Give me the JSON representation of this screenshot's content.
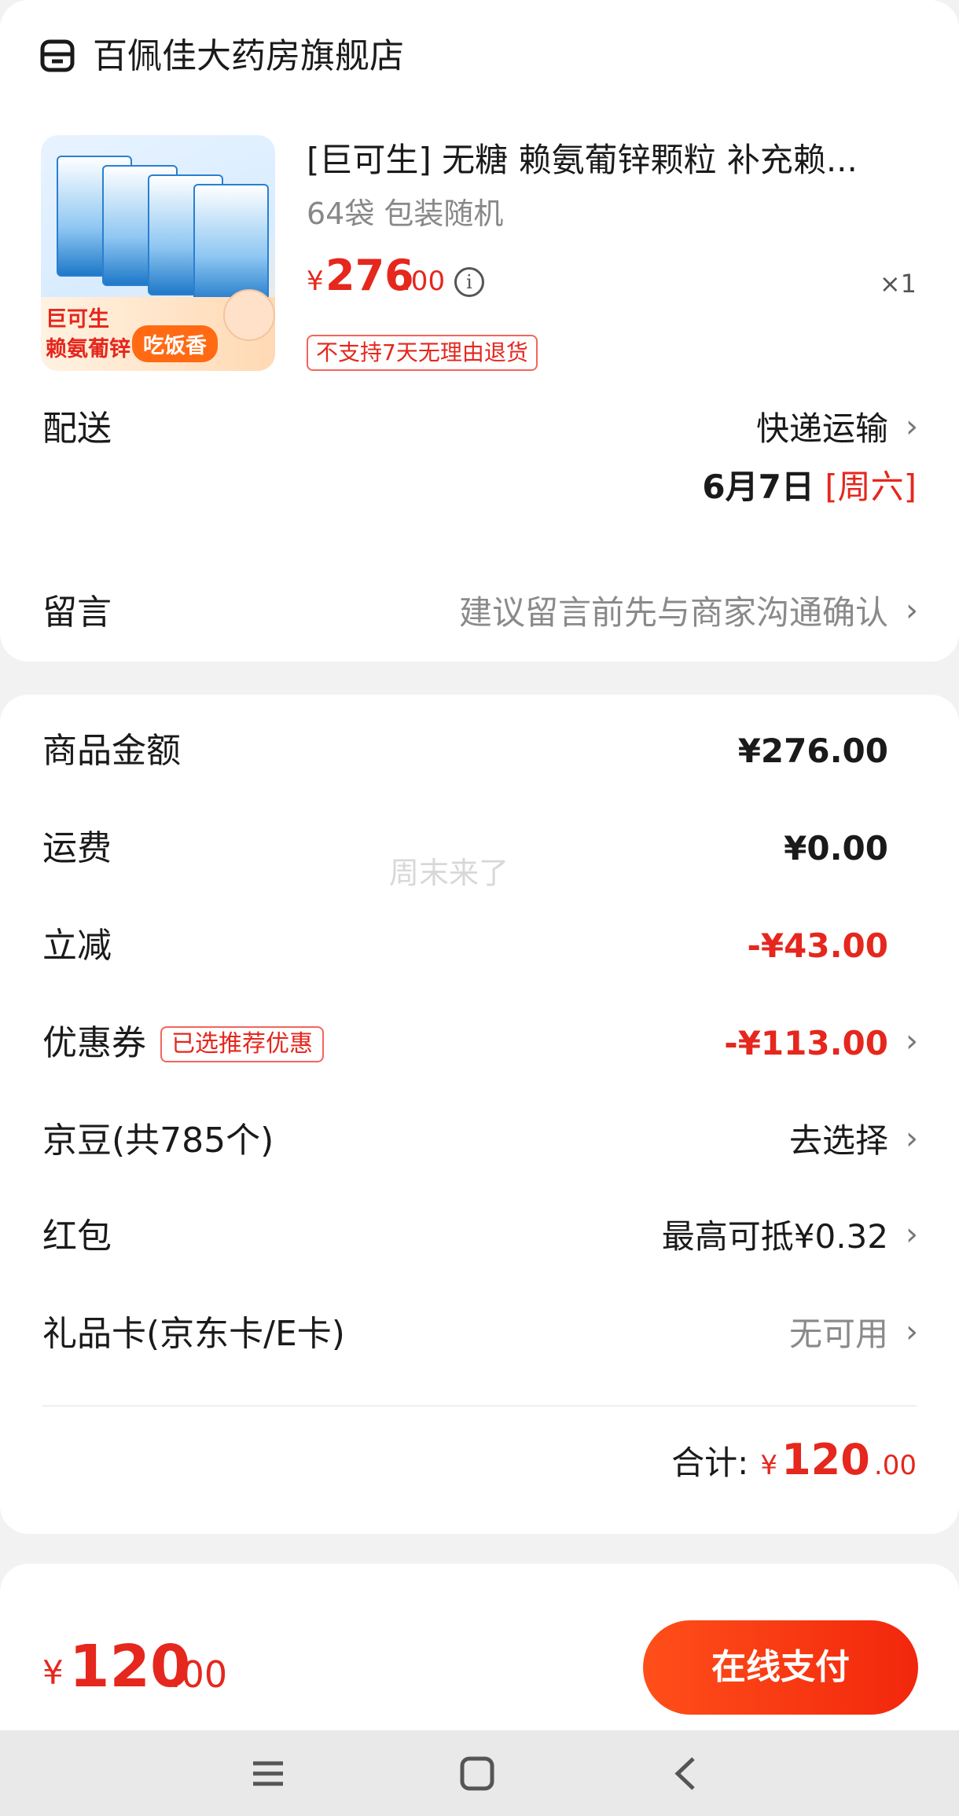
{
  "store": {
    "name": "百佩佳大药房旗舰店",
    "icon": "store-icon"
  },
  "product": {
    "title": "[巨可生] 无糖 赖氨葡锌颗粒 补充赖...",
    "spec": "64袋 包装随机",
    "price_symbol": "¥",
    "price_int": "276",
    "price_dec": ".00",
    "quantity": "×1",
    "return_tag": "不支持7天无理由退货",
    "thumb": {
      "brand": "巨可生",
      "name": "赖氨葡锌",
      "pill": "吃饭香"
    }
  },
  "delivery": {
    "label": "配送",
    "method": "快递运输",
    "date": "6月7日",
    "weekday": "[周六]"
  },
  "message": {
    "label": "留言",
    "placeholder": "建议留言前先与商家沟通确认"
  },
  "summary": {
    "goods_label": "商品金额",
    "goods_value": "¥276.00",
    "shipping_label": "运费",
    "shipping_value": "¥0.00",
    "discount_label": "立减",
    "discount_value": "-¥43.00",
    "coupon_label": "优惠券",
    "coupon_tag": "已选推荐优惠",
    "coupon_value": "-¥113.00",
    "beans_label": "京豆(共785个)",
    "beans_value": "去选择",
    "redpacket_label": "红包",
    "redpacket_value": "最高可抵¥0.32",
    "giftcard_label": "礼品卡(京东卡/E卡)",
    "giftcard_value": "无可用",
    "total_label": "合计:",
    "total_symbol": "¥",
    "total_int": "120",
    "total_dec": ".00"
  },
  "watermark": "周末来了",
  "footer": {
    "symbol": "¥",
    "int": "120",
    "dec": ".00",
    "pay_label": "在线支付"
  },
  "colors": {
    "accent": "#e5271d",
    "button": "#f2270c"
  }
}
